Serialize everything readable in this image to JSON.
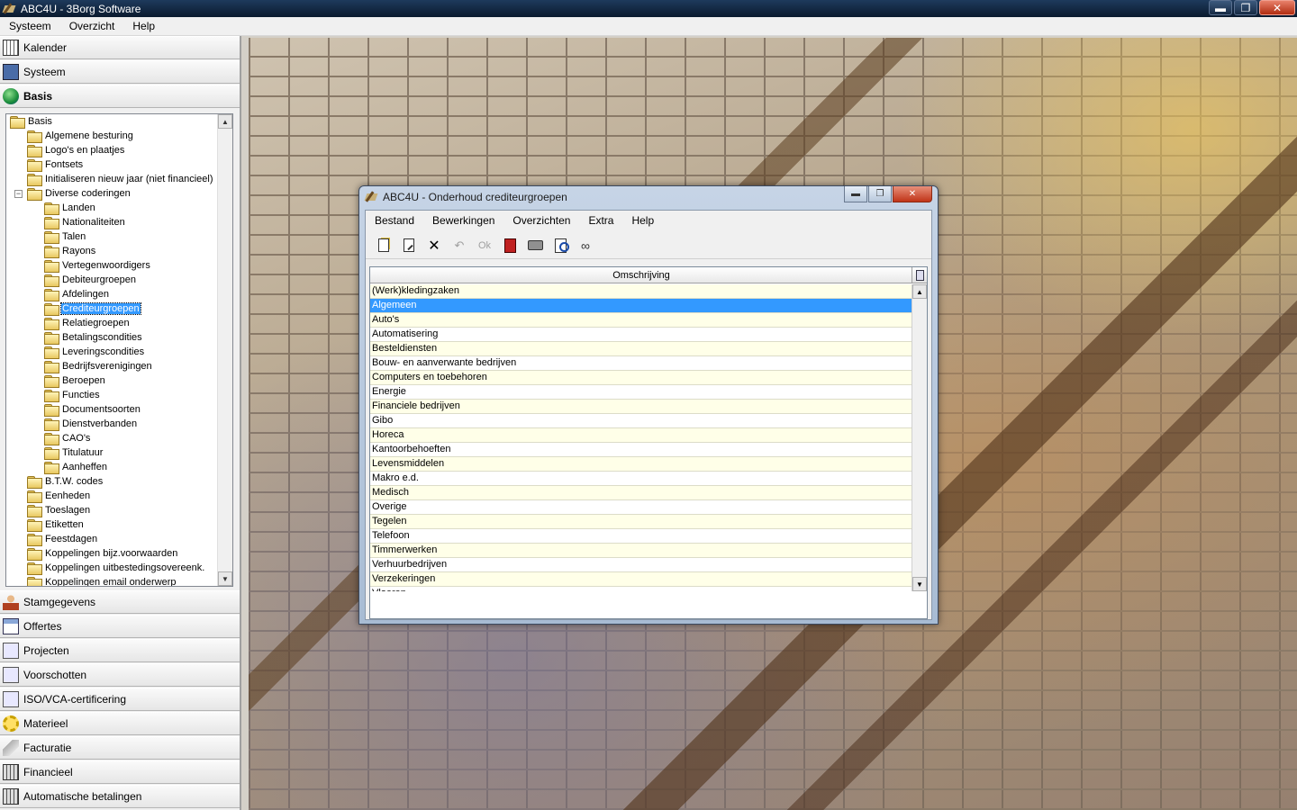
{
  "window": {
    "title": "ABC4U - 3Borg Software",
    "min": "▬",
    "restore": "❐",
    "close": "✕"
  },
  "menubar": [
    "Systeem",
    "Overzicht",
    "Help"
  ],
  "nav_top": [
    {
      "label": "Kalender",
      "icon": "calendar-icon"
    },
    {
      "label": "Systeem",
      "icon": "system-icon"
    },
    {
      "label": "Basis",
      "icon": "globe-icon"
    }
  ],
  "tree": {
    "items": [
      {
        "label": "Basis",
        "level": 0
      },
      {
        "label": "Algemene besturing",
        "level": 1
      },
      {
        "label": "Logo's en plaatjes",
        "level": 1
      },
      {
        "label": "Fontsets",
        "level": 1
      },
      {
        "label": "Initialiseren nieuw jaar (niet financieel)",
        "level": 1
      },
      {
        "label": "Diverse coderingen",
        "level": 1,
        "expander": "−"
      },
      {
        "label": "Landen",
        "level": 2
      },
      {
        "label": "Nationaliteiten",
        "level": 2
      },
      {
        "label": "Talen",
        "level": 2
      },
      {
        "label": "Rayons",
        "level": 2
      },
      {
        "label": "Vertegenwoordigers",
        "level": 2
      },
      {
        "label": "Debiteurgroepen",
        "level": 2
      },
      {
        "label": "Afdelingen",
        "level": 2
      },
      {
        "label": "Crediteurgroepen",
        "level": 2,
        "selected": true
      },
      {
        "label": "Relatiegroepen",
        "level": 2
      },
      {
        "label": "Betalingscondities",
        "level": 2
      },
      {
        "label": "Leveringscondities",
        "level": 2
      },
      {
        "label": "Bedrijfsverenigingen",
        "level": 2
      },
      {
        "label": "Beroepen",
        "level": 2
      },
      {
        "label": "Functies",
        "level": 2
      },
      {
        "label": "Documentsoorten",
        "level": 2
      },
      {
        "label": "Dienstverbanden",
        "level": 2
      },
      {
        "label": "CAO's",
        "level": 2
      },
      {
        "label": "Titulatuur",
        "level": 2
      },
      {
        "label": "Aanheffen",
        "level": 2
      },
      {
        "label": "B.T.W. codes",
        "level": 1
      },
      {
        "label": "Eenheden",
        "level": 1
      },
      {
        "label": "Toeslagen",
        "level": 1
      },
      {
        "label": "Etiketten",
        "level": 1
      },
      {
        "label": "Feestdagen",
        "level": 1
      },
      {
        "label": "Koppelingen bijz.voorwaarden",
        "level": 1
      },
      {
        "label": "Koppelingen uitbestedingsovereenk.",
        "level": 1
      },
      {
        "label": "Koppelingen email onderwerp",
        "level": 1
      }
    ]
  },
  "nav_bottom": [
    {
      "label": "Stamgegevens",
      "icon": "person-icon"
    },
    {
      "label": "Offertes",
      "icon": "spreadsheet-icon"
    },
    {
      "label": "Projecten",
      "icon": "document-icon"
    },
    {
      "label": "Voorschotten",
      "icon": "document-icon"
    },
    {
      "label": "ISO/VCA-certificering",
      "icon": "document-icon"
    },
    {
      "label": "Materieel",
      "icon": "gear-icon"
    },
    {
      "label": "Facturatie",
      "icon": "tag-icon"
    },
    {
      "label": "Financieel",
      "icon": "bank-icon"
    },
    {
      "label": "Automatische betalingen",
      "icon": "bank-icon"
    }
  ],
  "dialog": {
    "title": "ABC4U - Onderhoud crediteurgroepen",
    "menu": [
      "Bestand",
      "Bewerkingen",
      "Overzichten",
      "Extra",
      "Help"
    ],
    "toolbar": [
      {
        "name": "new-record-icon",
        "glyph": "",
        "disabled": false
      },
      {
        "name": "edit-record-icon",
        "glyph": "",
        "disabled": false
      },
      {
        "name": "delete-icon",
        "glyph": "✕",
        "disabled": false
      },
      {
        "name": "undo-icon",
        "glyph": "↶",
        "disabled": true
      },
      {
        "name": "ok-icon",
        "glyph": "Ok",
        "disabled": true
      },
      {
        "name": "exit-icon",
        "glyph": "",
        "disabled": false
      },
      {
        "name": "print-icon",
        "glyph": "",
        "disabled": false
      },
      {
        "name": "print-preview-icon",
        "glyph": "",
        "disabled": false
      },
      {
        "name": "binoculars-icon",
        "glyph": "∞",
        "disabled": false
      }
    ],
    "column_header": "Omschrijving",
    "rows": [
      "(Werk)kledingzaken",
      "Algemeen",
      "Auto's",
      "Automatisering",
      "Besteldiensten",
      "Bouw- en aanverwante bedrijven",
      "Computers en toebehoren",
      "Energie",
      "Financiele bedrijven",
      "Gibo",
      "Horeca",
      "Kantoorbehoeften",
      "Levensmiddelen",
      "Makro e.d.",
      "Medisch",
      "Overige",
      "Tegelen",
      "Telefoon",
      "Timmerwerken",
      "Verhuurbedrijven",
      "Verzekeringen",
      "Vloeren"
    ],
    "selected_row": 1
  }
}
